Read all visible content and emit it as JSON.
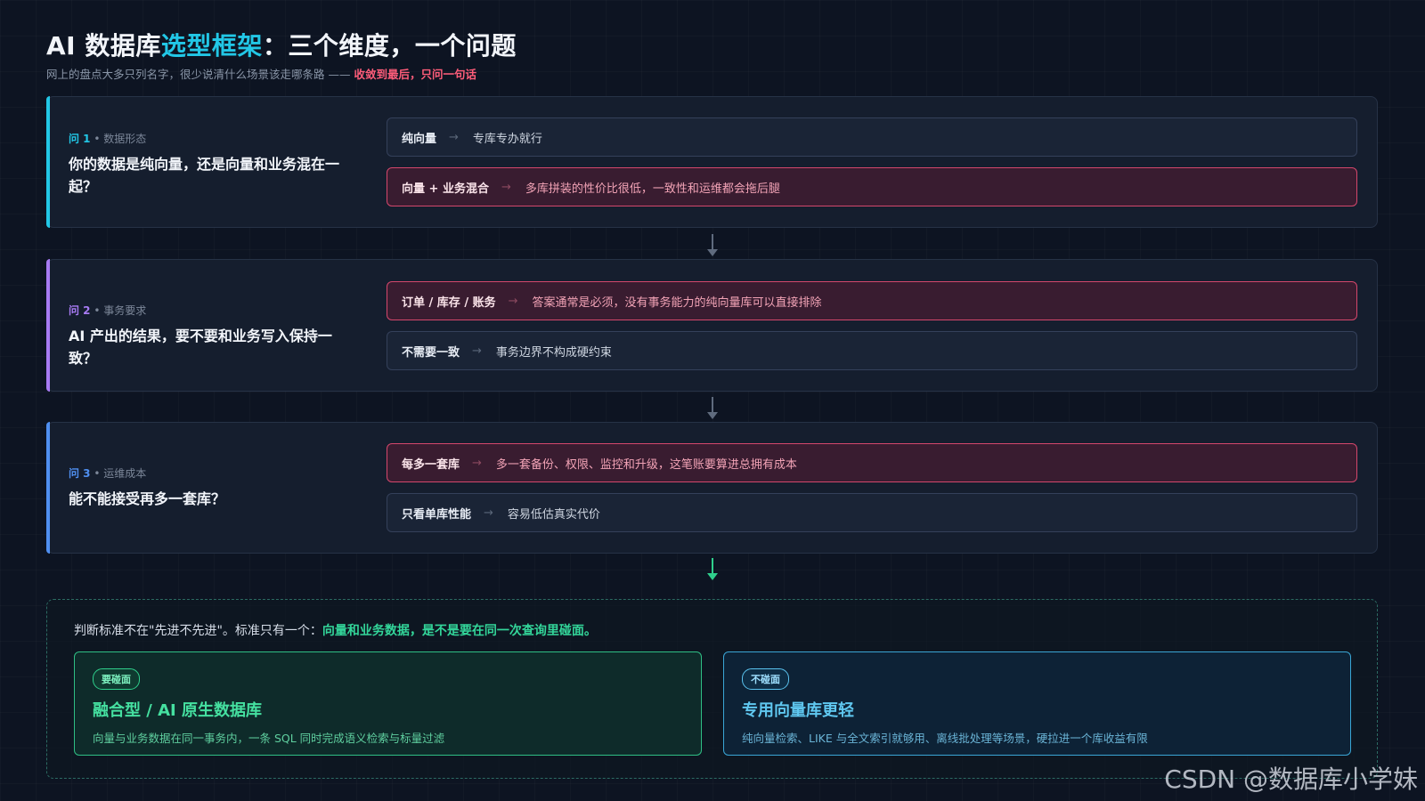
{
  "header": {
    "title_pre": "AI 数据库",
    "title_hl": "选型框架",
    "title_post": "：三个维度，一个问题",
    "subtitle_pre": "网上的盘点大多只列名字，很少说清什么场景该走哪条路 —— ",
    "subtitle_hl": "收敛到最后，只问一句话"
  },
  "arrow_glyph": "→",
  "questions": [
    {
      "num": "问 1",
      "sep": " • ",
      "tag": "数据形态",
      "title": "你的数据是纯向量，还是向量和业务混在一起？",
      "accent": "#22c7e6",
      "options": [
        {
          "label": "纯向量",
          "desc": "专库专办就行",
          "highlight": false
        },
        {
          "label": "向量 + 业务混合",
          "desc": "多库拼装的性价比很低，一致性和运维都会拖后腿",
          "highlight": true
        }
      ]
    },
    {
      "num": "问 2",
      "sep": " • ",
      "tag": "事务要求",
      "title": "AI 产出的结果，要不要和业务写入保持一致？",
      "accent": "#a77bf3",
      "options": [
        {
          "label": "订单 / 库存 / 账务",
          "desc": "答案通常是必须，没有事务能力的纯向量库可以直接排除",
          "highlight": true
        },
        {
          "label": "不需要一致",
          "desc": "事务边界不构成硬约束",
          "highlight": false
        }
      ]
    },
    {
      "num": "问 3",
      "sep": " • ",
      "tag": "运维成本",
      "title": "能不能接受再多一套库？",
      "accent": "#4f8ff0",
      "options": [
        {
          "label": "每多一套库",
          "desc": "多一套备份、权限、监控和升级，这笔账要算进总拥有成本",
          "highlight": true
        },
        {
          "label": "只看单库性能",
          "desc": "容易低估真实代价",
          "highlight": false
        }
      ]
    }
  ],
  "verdict": {
    "text_pre": "判断标准不在\"先进不先进\"。标准只有一个：",
    "text_hl": "向量和业务数据，是不是要在同一次查询里碰面。",
    "boxes": [
      {
        "badge": "要碰面",
        "title": "融合型 / AI 原生数据库",
        "desc": "向量与业务数据在同一事务内，一条 SQL 同时完成语义检索与标量过滤",
        "color": "#2fcf8c"
      },
      {
        "badge": "不碰面",
        "title": "专用向量库更轻",
        "desc": "纯向量检索、LIKE 与全文索引就够用、离线批处理等场景，硬拉进一个库收益有限",
        "color": "#3aa6d6"
      }
    ]
  },
  "watermark": "CSDN @数据库小学妹"
}
